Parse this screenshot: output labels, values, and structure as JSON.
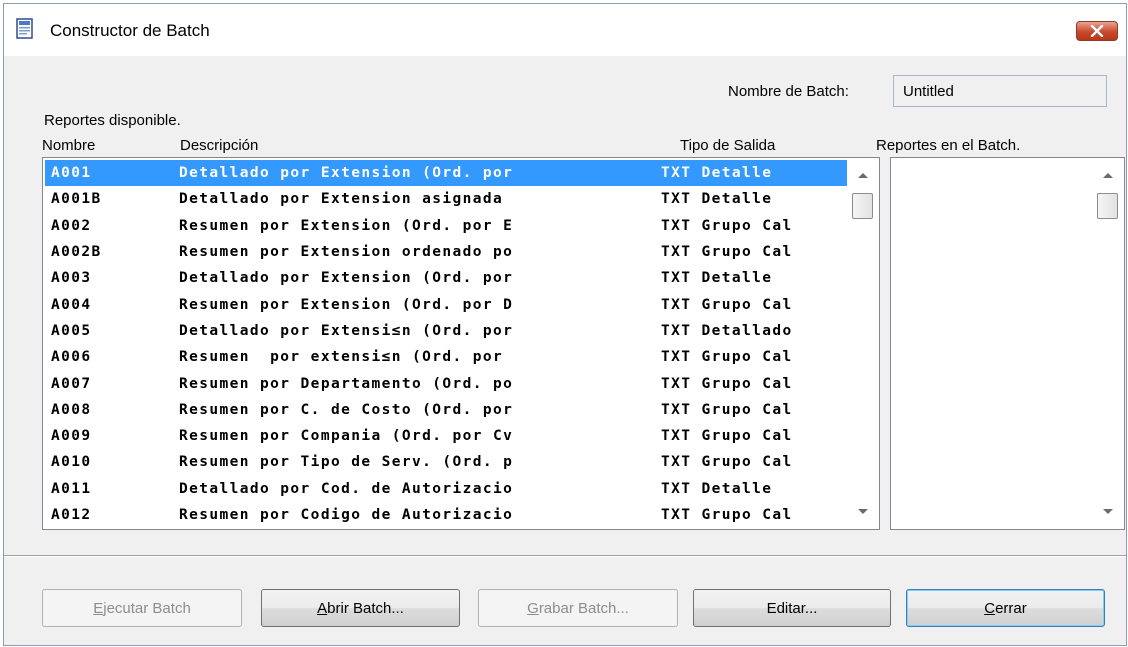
{
  "window": {
    "title": "Constructor de Batch"
  },
  "batch_name": {
    "label": "Nombre de Batch:",
    "value": "Untitled"
  },
  "available": {
    "label": "Reportes disponible.",
    "columns": {
      "name": "Nombre",
      "description": "Descripción",
      "output": "Tipo de Salida"
    },
    "rows": [
      {
        "code": "A001",
        "description": "Detallado por Extension (Ord. por",
        "output": "TXT Detalle"
      },
      {
        "code": "A001B",
        "description": "Detallado por Extension asignada",
        "output": "TXT Detalle"
      },
      {
        "code": "A002",
        "description": "Resumen por Extension (Ord. por E",
        "output": "TXT Grupo Cal"
      },
      {
        "code": "A002B",
        "description": "Resumen por Extension ordenado po",
        "output": "TXT Grupo Cal"
      },
      {
        "code": "A003",
        "description": "Detallado por Extension (Ord. por",
        "output": "TXT Detalle"
      },
      {
        "code": "A004",
        "description": "Resumen por Extension (Ord. por D",
        "output": "TXT Grupo Cal"
      },
      {
        "code": "A005",
        "description": "Detallado por Extensi≤n (Ord. por",
        "output": "TXT Detallado"
      },
      {
        "code": "A006",
        "description": "Resumen  por extensi≤n (Ord. por",
        "output": "TXT Grupo Cal"
      },
      {
        "code": "A007",
        "description": "Resumen por Departamento (Ord. po",
        "output": "TXT Grupo Cal"
      },
      {
        "code": "A008",
        "description": "Resumen por C. de Costo (Ord. por",
        "output": "TXT Grupo Cal"
      },
      {
        "code": "A009",
        "description": "Resumen por Compania (Ord. por Cv",
        "output": "TXT Grupo Cal"
      },
      {
        "code": "A010",
        "description": "Resumen por Tipo de Serv. (Ord. p",
        "output": "TXT Grupo Cal"
      },
      {
        "code": "A011",
        "description": "Detallado por Cod. de Autorizacio",
        "output": "TXT Detalle"
      },
      {
        "code": "A012",
        "description": "Resumen por Codigo de Autorizacio",
        "output": "TXT Grupo Cal"
      }
    ],
    "selected_index": 0
  },
  "batch": {
    "label": "Reportes en el Batch."
  },
  "buttons": {
    "run": {
      "mnemonic": "E",
      "rest": "jecutar Batch"
    },
    "open": {
      "mnemonic": "A",
      "rest": "brir Batch..."
    },
    "save": {
      "mnemonic": "G",
      "rest": "rabar Batch..."
    },
    "edit": {
      "label": "Editar..."
    },
    "close": {
      "mnemonic": "C",
      "rest": "errar"
    }
  },
  "colors": {
    "selection": "#3399ff",
    "window_bg": "#f0f0f0",
    "close_button": "#c9482e"
  },
  "icons": {
    "app": "document-window-icon",
    "close": "close-icon"
  }
}
